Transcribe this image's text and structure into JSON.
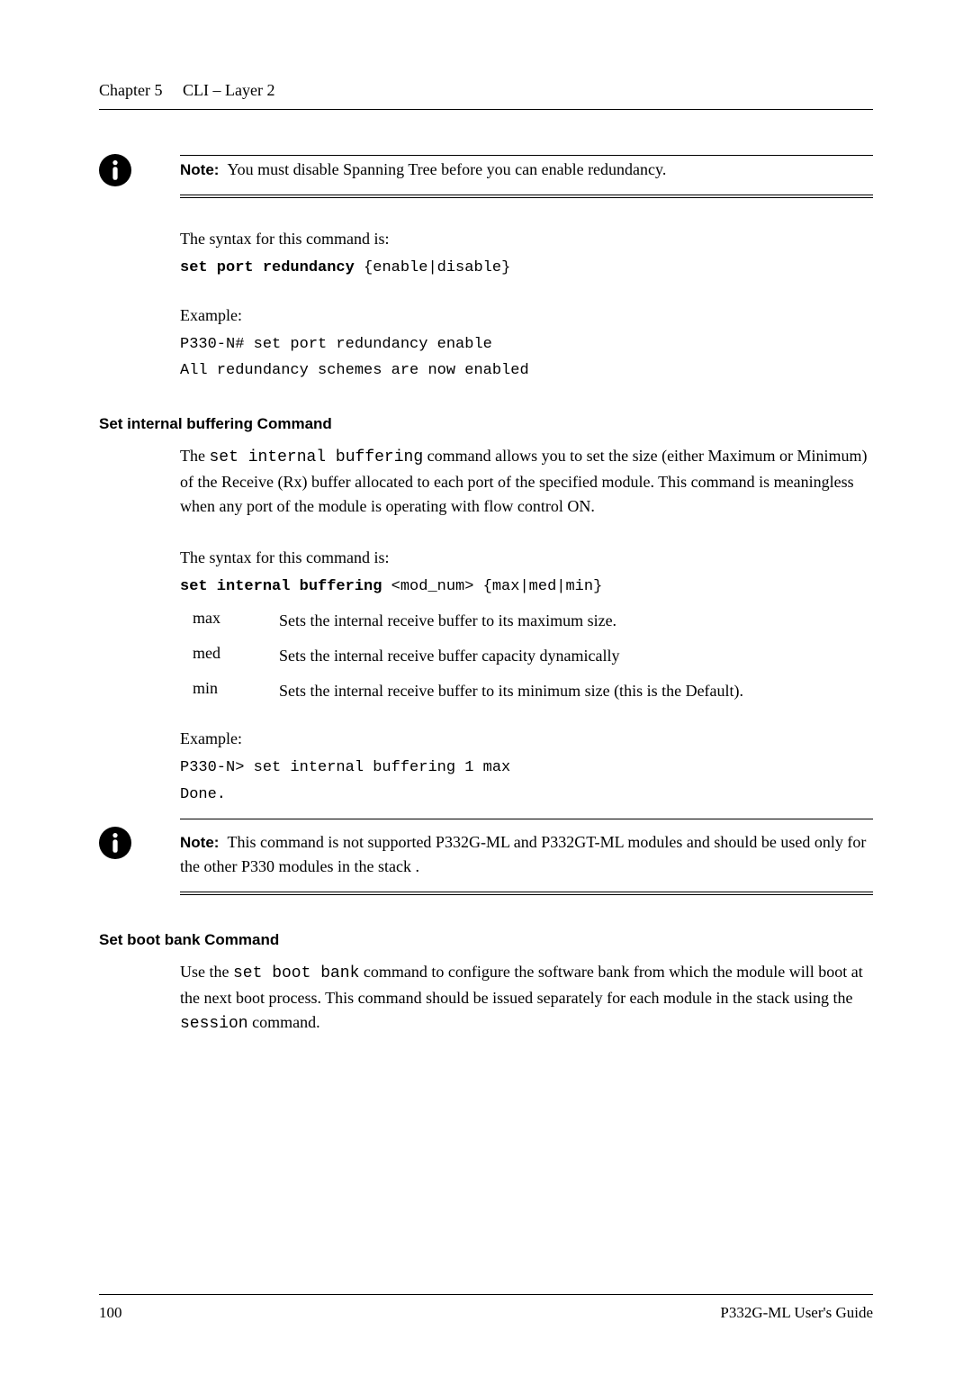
{
  "header": {
    "chapter": "Chapter 5",
    "title": "CLI – Layer 2"
  },
  "note1": {
    "label": "Note:",
    "text": "You must disable Spanning Tree before you can enable redundancy."
  },
  "section1": {
    "syntaxIntro": "The syntax for this command is:",
    "syntaxCmd": "set port redundancy",
    "syntaxArgs": " {enable|disable}",
    "exampleLabel": "Example:",
    "exampleLine1": "P330-N# set port redundancy enable",
    "exampleLine2": "All redundancy schemes are now enabled"
  },
  "section2": {
    "heading": "Set internal buffering Command",
    "para1a": "The ",
    "para1code": "set internal buffering",
    "para1b": " command allows you to set the size (either Maximum or Minimum) of the Receive (Rx) buffer allocated to each port of the specified module. This command is meaningless when any port of the module is operating with flow control ON.",
    "syntaxIntro": "The syntax for this command is:",
    "syntaxCmd": "set internal buffering",
    "syntaxArgs": " <mod_num> {max|med|min}",
    "params": [
      {
        "name": "max",
        "desc": "Sets the internal receive buffer to its maximum size."
      },
      {
        "name": "med",
        "desc": "Sets the internal receive buffer capacity dynamically"
      },
      {
        "name": "min",
        "desc": "Sets the internal receive buffer to its minimum size (this is the Default)."
      }
    ],
    "exampleLabel": "Example:",
    "exampleLine1": "P330-N> set internal buffering 1 max",
    "exampleLine2": "Done."
  },
  "note2": {
    "label": "Note:",
    "text": "This command is not supported P332G-ML and P332GT-ML modules and should be used only for the other P330 modules in the stack ."
  },
  "section3": {
    "heading": "Set boot bank Command",
    "para1a": "Use the ",
    "para1code1": "set boot bank",
    "para1b": " command to configure the software bank from which the module will boot at the next boot process. This command should be issued separately for each module in the stack using the ",
    "para1code2": "session",
    "para1c": " command."
  },
  "footer": {
    "pageNum": "100",
    "docTitle": "P332G-ML User's Guide"
  }
}
